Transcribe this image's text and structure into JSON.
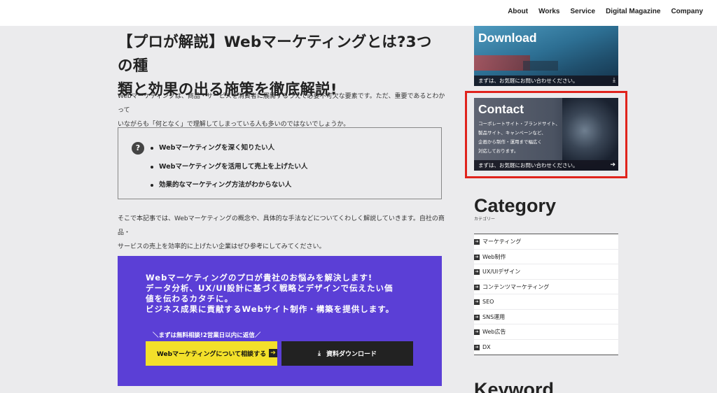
{
  "nav": [
    "About",
    "Works",
    "Service",
    "Digital Magazine",
    "Company"
  ],
  "article": {
    "title_line1": "【プロが解説】Webマーケティングとは?3つの種",
    "title_line2": "類と効果の出る施策を徹底解説!",
    "intro_line1": "Webマーケティングは、商品・サービスを消費者に展開するうえで必要不可欠な要素です。ただ、重要であるとわかって",
    "intro_line2": "いながらも「何となく」で理解してしまっている人も多いのではないでしょうか。",
    "checklist": [
      "Webマーケティングを深く知りたい人",
      "Webマーケティングを活用して売上を上げたい人",
      "効果的なマーケティング方法がわからない人"
    ],
    "body_line1": "そこで本記事では、Webマーケティングの概念や、具体的な手法などについてくわしく解説していきます。自社の商品・",
    "body_line2": "サービスの売上を効率的に上げたい企業はぜひ参考にしてみてください。"
  },
  "cta": {
    "line1": "Webマーケティングのプロが貴社のお悩みを解決します!",
    "line2": "データ分析、UX/UI設計に基づく戦略とデザインで伝えたい価",
    "line3": "値を伝わるカタチに。",
    "line4": "ビジネス成果に貢献するWebサイト制作・構築を提供します。",
    "note": "＼まずは無料相談!2営業日以内に返信／",
    "consult_label": "Webマーケティングについて相談する",
    "download_label": "資料ダウンロード"
  },
  "sidebar": {
    "download_title": "Download",
    "download_bar": "まずは、お気軽にお問い合わせください。",
    "contact_title": "Contact",
    "contact_desc1": "コーポレートサイト・ブランドサイト、",
    "contact_desc2": "製品サイト、キャンペーンなど、",
    "contact_desc3": "企画から制作・運用まで幅広く",
    "contact_desc4": "対応しております。",
    "contact_bar": "まずは、お気軽にお問い合わせください。",
    "category_title": "Category",
    "category_sub": "カテゴリー",
    "categories": [
      "マーケティング",
      "Web制作",
      "UX/UIデザイン",
      "コンテンツマーケティング",
      "SEO",
      "SNS運用",
      "Web広告",
      "DX"
    ],
    "keyword_title": "Keyword"
  },
  "colors": {
    "cta_bg": "#5b3fd6",
    "yellow_button": "#f3e02a",
    "highlight_border": "#e0231c"
  }
}
